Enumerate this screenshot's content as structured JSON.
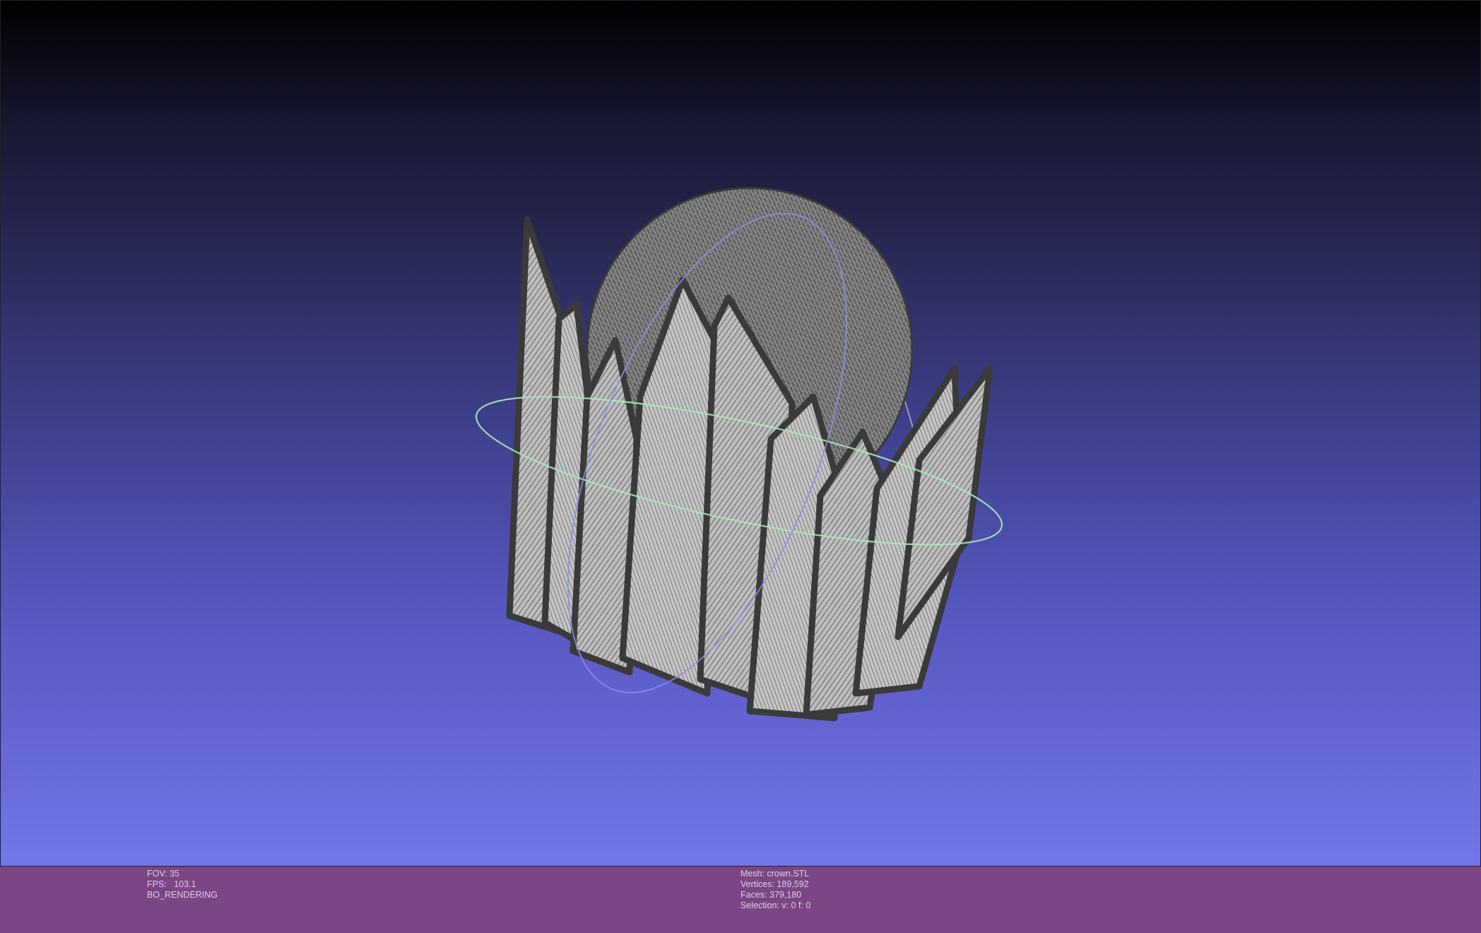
{
  "viewport": {
    "colors": {
      "background_top": "#000000",
      "background_bottom": "#7475e9",
      "mesh_edge": "#3e3e3e",
      "mesh_face": "#c9c9c9",
      "trackball_x": "#cfa3c9",
      "trackball_y": "#8d8de8",
      "trackball_z": "#a8e8b8"
    }
  },
  "info": {
    "left": {
      "fov": "FOV: 35",
      "fps": "FPS:   103.1",
      "mode": "BO_RENDERING"
    },
    "right": {
      "mesh": "Mesh: crown.STL",
      "vertices": "Vertices: 189,592",
      "faces": "Faces: 379,180",
      "selection": "Selection: v: 0 f: 0"
    },
    "colors": {
      "bar_background": "#7c4585",
      "text": "#d9d4e2"
    }
  }
}
